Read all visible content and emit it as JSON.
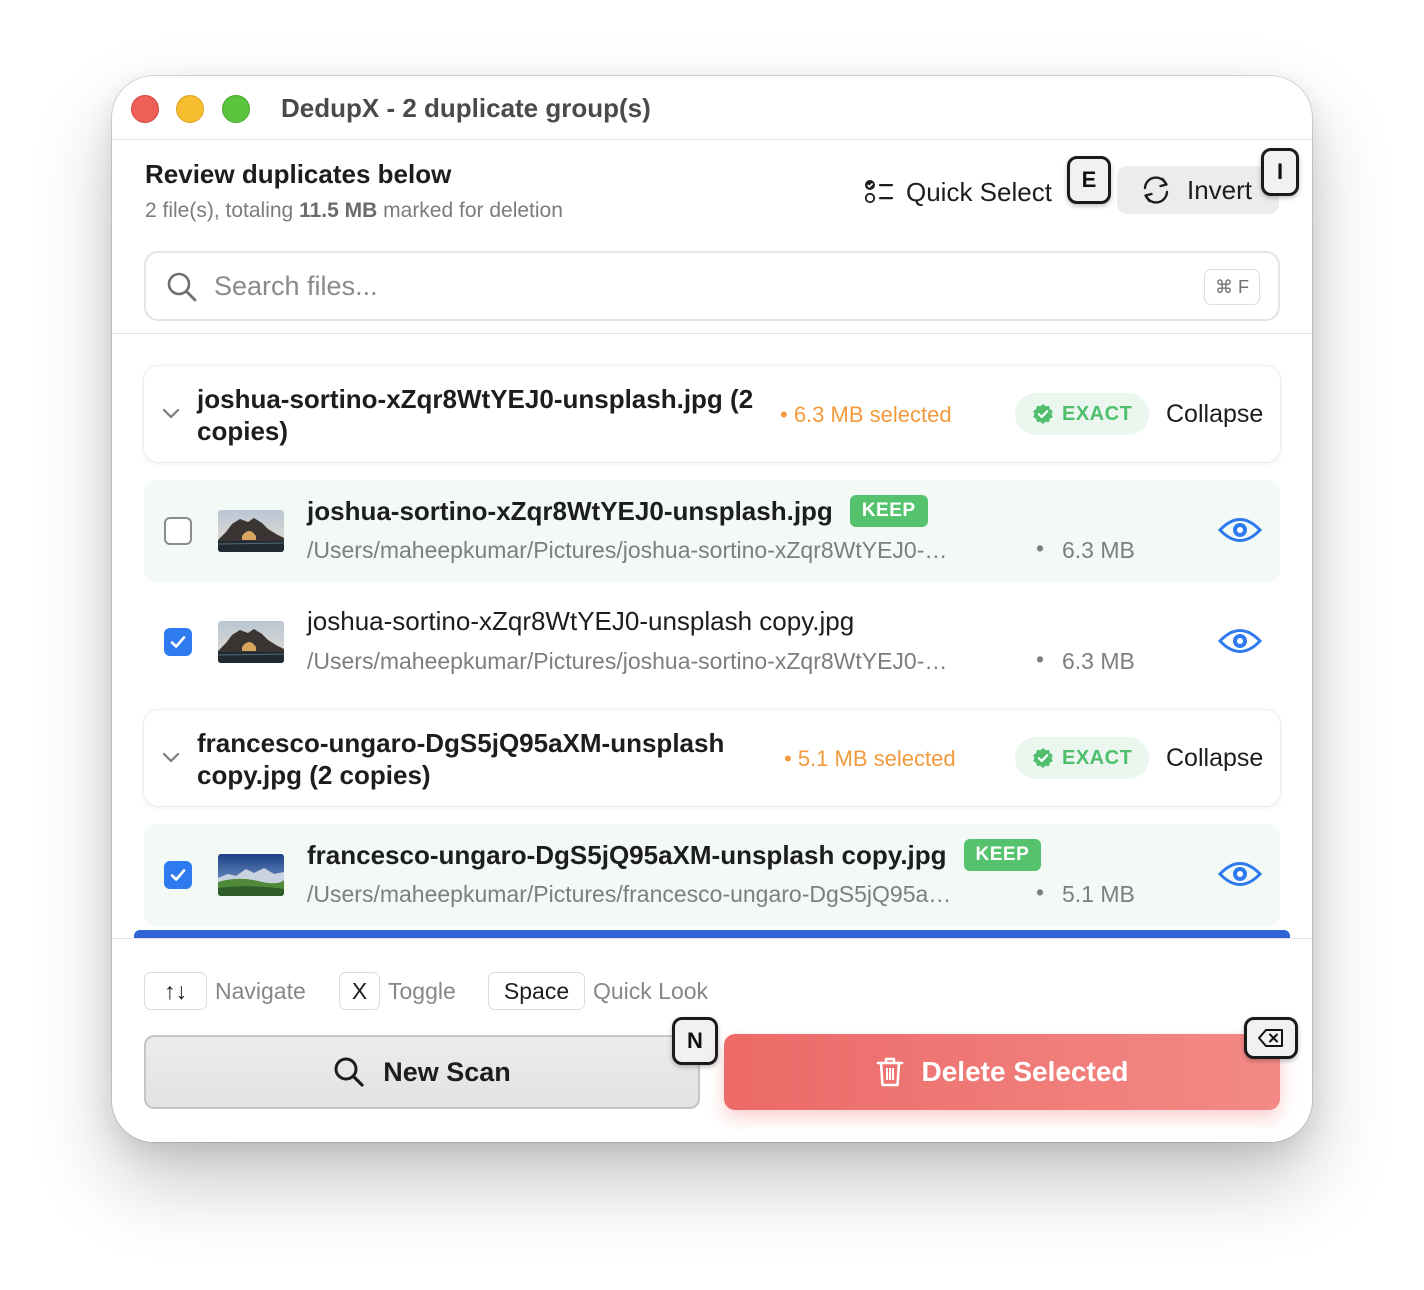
{
  "window": {
    "title": "DedupX - 2 duplicate group(s)"
  },
  "header": {
    "title": "Review duplicates below",
    "summary_count": "2 file(s), totaling",
    "summary_size": "11.5 MB",
    "summary_suffix": "marked for deletion",
    "quick_select_label": "Quick Select",
    "quick_select_key": "E",
    "invert_label": "Invert",
    "invert_key": "I"
  },
  "search": {
    "placeholder": "Search files...",
    "value": "",
    "shortcut": "⌘ F"
  },
  "groups": [
    {
      "name": "joshua-sortino-xZqr8WtYEJ0-unsplash.jpg (2 copies)",
      "selected": "• 6.3 MB selected",
      "match_type": "EXACT",
      "collapse_label": "Collapse",
      "files": [
        {
          "name": "joshua-sortino-xZqr8WtYEJ0-unsplash.jpg",
          "keep_badge": "KEEP",
          "path": "/Users/maheepkumar/Pictures/joshua-sortino-xZqr8WtYEJ0-…",
          "separator": "•",
          "size": "6.3 MB",
          "checked": false
        },
        {
          "name": "joshua-sortino-xZqr8WtYEJ0-unsplash copy.jpg",
          "path": "/Users/maheepkumar/Pictures/joshua-sortino-xZqr8WtYEJ0-…",
          "separator": "•",
          "size": "6.3 MB",
          "checked": true
        }
      ]
    },
    {
      "name": "francesco-ungaro-DgS5jQ95aXM-unsplash copy.jpg (2 copies)",
      "selected": "• 5.1 MB selected",
      "match_type": "EXACT",
      "collapse_label": "Collapse",
      "files": [
        {
          "name": "francesco-ungaro-DgS5jQ95aXM-unsplash copy.jpg",
          "keep_badge": "KEEP",
          "path": "/Users/maheepkumar/Pictures/francesco-ungaro-DgS5jQ95a…",
          "separator": "•",
          "size": "5.1 MB",
          "checked": true
        }
      ]
    }
  ],
  "footer": {
    "hints": [
      {
        "key": "↑↓",
        "label": "Navigate"
      },
      {
        "key": "X",
        "label": "Toggle"
      },
      {
        "key": "Space",
        "label": "Quick Look"
      }
    ],
    "new_scan_label": "New Scan",
    "new_scan_key": "N",
    "delete_label": "Delete Selected",
    "delete_key_icon": "delete-key-icon"
  },
  "colors": {
    "accent": "#2e7bf0",
    "selected_orange": "#f29a3c",
    "keep_green": "#55c26d",
    "exact_green": "#4fbe6d",
    "delete_red": "#ec6a68",
    "keep_row_bg": "#f3f9f4"
  },
  "icons": {
    "quick_select": "checklist-icon",
    "invert": "arrow-cycle-icon",
    "search": "search-icon",
    "collapse": "chevron-down-icon",
    "exact": "verified-badge-icon",
    "preview": "eye-icon",
    "checkbox": "checkmark-icon",
    "new_scan": "search-icon",
    "delete": "trash-icon"
  }
}
